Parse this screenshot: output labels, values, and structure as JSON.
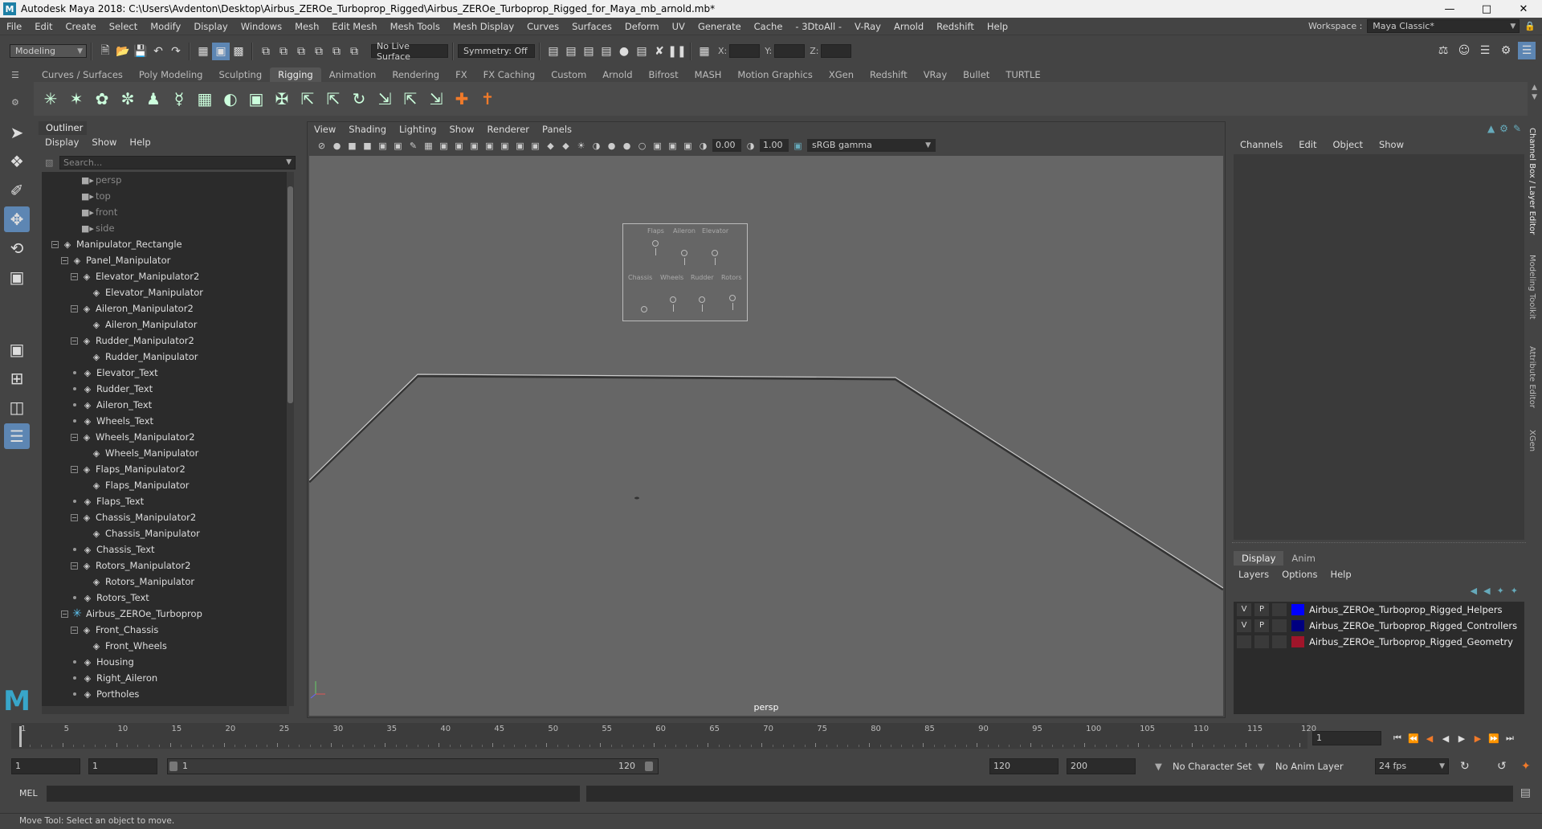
{
  "window": {
    "title": "Autodesk Maya 2018: C:\\Users\\Avdenton\\Desktop\\Airbus_ZEROe_Turboprop_Rigged\\Airbus_ZEROe_Turboprop_Rigged_for_Maya_mb_arnold.mb*",
    "logo": "M"
  },
  "menubar": {
    "items": [
      "File",
      "Edit",
      "Create",
      "Select",
      "Modify",
      "Display",
      "Windows",
      "Mesh",
      "Edit Mesh",
      "Mesh Tools",
      "Mesh Display",
      "Curves",
      "Surfaces",
      "Deform",
      "UV",
      "Generate",
      "Cache",
      "- 3DtoAll -",
      "V-Ray",
      "Arnold",
      "Redshift",
      "Help"
    ],
    "workspace_label": "Workspace :",
    "workspace_value": "Maya Classic*"
  },
  "statusline": {
    "mode": "Modeling",
    "live_surface": "No Live Surface",
    "symmetry": "Symmetry: Off",
    "x_label": "X:",
    "y_label": "Y:",
    "z_label": "Z:"
  },
  "shelf": {
    "tabs": [
      "Curves / Surfaces",
      "Poly Modeling",
      "Sculpting",
      "Rigging",
      "Animation",
      "Rendering",
      "FX",
      "FX Caching",
      "Custom",
      "Arnold",
      "Bifrost",
      "MASH",
      "Motion Graphics",
      "XGen",
      "Redshift",
      "VRay",
      "Bullet",
      "TURTLE"
    ],
    "active_tab": "Rigging"
  },
  "outliner": {
    "title": "Outliner",
    "menu": [
      "Display",
      "Show",
      "Help"
    ],
    "search_placeholder": "Search...",
    "nodes": [
      {
        "label": "persp",
        "depth": 2,
        "kind": "camera",
        "expander": ""
      },
      {
        "label": "top",
        "depth": 2,
        "kind": "camera",
        "expander": ""
      },
      {
        "label": "front",
        "depth": 2,
        "kind": "camera",
        "expander": ""
      },
      {
        "label": "side",
        "depth": 2,
        "kind": "camera",
        "expander": ""
      },
      {
        "label": "Manipulator_Rectangle",
        "depth": 0,
        "kind": "transform",
        "expander": "-"
      },
      {
        "label": "Panel_Manipulator",
        "depth": 1,
        "kind": "transform",
        "expander": "-"
      },
      {
        "label": "Elevator_Manipulator2",
        "depth": 2,
        "kind": "transform",
        "expander": "-"
      },
      {
        "label": "Elevator_Manipulator",
        "depth": 3,
        "kind": "transform",
        "expander": ""
      },
      {
        "label": "Aileron_Manipulator2",
        "depth": 2,
        "kind": "transform",
        "expander": "-"
      },
      {
        "label": "Aileron_Manipulator",
        "depth": 3,
        "kind": "transform",
        "expander": ""
      },
      {
        "label": "Rudder_Manipulator2",
        "depth": 2,
        "kind": "transform",
        "expander": "-"
      },
      {
        "label": "Rudder_Manipulator",
        "depth": 3,
        "kind": "transform",
        "expander": ""
      },
      {
        "label": "Elevator_Text",
        "depth": 2,
        "kind": "transform",
        "expander": "dot"
      },
      {
        "label": "Rudder_Text",
        "depth": 2,
        "kind": "transform",
        "expander": "dot"
      },
      {
        "label": "Aileron_Text",
        "depth": 2,
        "kind": "transform",
        "expander": "dot"
      },
      {
        "label": "Wheels_Text",
        "depth": 2,
        "kind": "transform",
        "expander": "dot"
      },
      {
        "label": "Wheels_Manipulator2",
        "depth": 2,
        "kind": "transform",
        "expander": "-"
      },
      {
        "label": "Wheels_Manipulator",
        "depth": 3,
        "kind": "transform",
        "expander": ""
      },
      {
        "label": "Flaps_Manipulator2",
        "depth": 2,
        "kind": "transform",
        "expander": "-"
      },
      {
        "label": "Flaps_Manipulator",
        "depth": 3,
        "kind": "transform",
        "expander": ""
      },
      {
        "label": "Flaps_Text",
        "depth": 2,
        "kind": "transform",
        "expander": "dot"
      },
      {
        "label": "Chassis_Manipulator2",
        "depth": 2,
        "kind": "transform",
        "expander": "-"
      },
      {
        "label": "Chassis_Manipulator",
        "depth": 3,
        "kind": "transform",
        "expander": ""
      },
      {
        "label": "Chassis_Text",
        "depth": 2,
        "kind": "transform",
        "expander": "dot"
      },
      {
        "label": "Rotors_Manipulator2",
        "depth": 2,
        "kind": "transform",
        "expander": "-"
      },
      {
        "label": "Rotors_Manipulator",
        "depth": 3,
        "kind": "transform",
        "expander": ""
      },
      {
        "label": "Rotors_Text",
        "depth": 2,
        "kind": "transform",
        "expander": "dot"
      },
      {
        "label": "Airbus_ZEROe_Turboprop",
        "depth": 1,
        "kind": "joint",
        "expander": "-"
      },
      {
        "label": "Front_Chassis",
        "depth": 2,
        "kind": "transform",
        "expander": "-"
      },
      {
        "label": "Front_Wheels",
        "depth": 3,
        "kind": "transform",
        "expander": ""
      },
      {
        "label": "Housing",
        "depth": 2,
        "kind": "transform",
        "expander": "dot"
      },
      {
        "label": "Right_Aileron",
        "depth": 2,
        "kind": "transform",
        "expander": "dot"
      },
      {
        "label": "Portholes",
        "depth": 2,
        "kind": "transform",
        "expander": "dot"
      }
    ]
  },
  "viewport": {
    "menu": [
      "View",
      "Shading",
      "Lighting",
      "Show",
      "Renderer",
      "Panels"
    ],
    "exposure": "0.00",
    "gamma_value": "1.00",
    "color_space": "sRGB gamma",
    "camera_label": "persp",
    "panel_labels": [
      "Flaps",
      "Aileron",
      "Elevator",
      "Chassis",
      "Wheels",
      "Rudder",
      "Rotors"
    ]
  },
  "channelbox": {
    "menu": [
      "Channels",
      "Edit",
      "Object",
      "Show"
    ],
    "layer_tabs": [
      "Display",
      "Anim"
    ],
    "active_layer_tab": "Display",
    "layer_menu": [
      "Layers",
      "Options",
      "Help"
    ],
    "layers": [
      {
        "v": "V",
        "p": "P",
        "color": "#0000ff",
        "name": "Airbus_ZEROe_Turboprop_Rigged_Helpers"
      },
      {
        "v": "V",
        "p": "P",
        "color": "#000080",
        "name": "Airbus_ZEROe_Turboprop_Rigged_Controllers"
      },
      {
        "v": "",
        "p": "",
        "color": "#a0152a",
        "name": "Airbus_ZEROe_Turboprop_Rigged_Geometry"
      }
    ]
  },
  "side_tabs": [
    "Channel Box / Layer Editor",
    "Modeling Toolkit",
    "Attribute Editor",
    "XGen"
  ],
  "timeslider": {
    "ticks": [
      1,
      5,
      10,
      15,
      20,
      25,
      30,
      35,
      40,
      45,
      50,
      55,
      60,
      65,
      70,
      75,
      80,
      85,
      90,
      95,
      100,
      105,
      110,
      115,
      120
    ],
    "tick_labels": [
      "1",
      "5",
      "10",
      "15",
      "20",
      "25",
      "30",
      "35",
      "40",
      "45",
      "50",
      "55",
      "60",
      "65",
      "70",
      "75",
      "80",
      "85",
      "90",
      "95",
      "100",
      "105",
      "110",
      "115",
      "120"
    ],
    "current_frame": "1"
  },
  "range": {
    "start": "1",
    "playback_start": "1",
    "slider_start": "1",
    "slider_end": "120",
    "playback_end": "120",
    "end": "200",
    "character_set": "No Character Set",
    "anim_layer": "No Anim Layer",
    "fps": "24 fps"
  },
  "commandline": {
    "language": "MEL"
  },
  "helpline": {
    "text": "Move Tool: Select an object to move."
  }
}
